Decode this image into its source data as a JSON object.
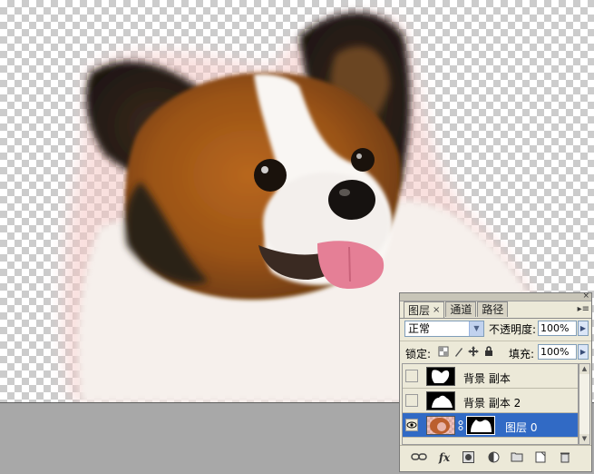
{
  "panel": {
    "tabs": [
      {
        "label": "图层",
        "close": "×"
      },
      {
        "label": "通道"
      },
      {
        "label": "路径"
      }
    ],
    "close_glyph": "×",
    "menu_glyph": "▸≡",
    "blend_mode": "正常",
    "opacity_label": "不透明度:",
    "opacity_value": "100%",
    "lock_label": "锁定:",
    "lock_icons": [
      "lock-transparent-icon",
      "lock-paint-icon",
      "lock-move-icon",
      "lock-all-icon"
    ],
    "fill_label": "填充:",
    "fill_value": "100%",
    "layers": [
      {
        "name": "背景 副本",
        "visible": false,
        "selected": false,
        "thumb": "mask-thumbnail"
      },
      {
        "name": "背景 副本 2",
        "visible": false,
        "selected": false,
        "thumb": "mask-thumbnail"
      },
      {
        "name": "图层 0",
        "visible": true,
        "selected": true,
        "thumb": "image-and-mask-thumbnail"
      }
    ],
    "bottom_icons": [
      "link-layers-icon",
      "fx-icon",
      "add-mask-icon",
      "adjustment-layer-icon",
      "new-group-icon",
      "new-layer-icon",
      "trash-icon"
    ],
    "fx_label": "fx"
  },
  "colors": {
    "selection": "#316ac5",
    "panel_bg": "#ece9d8",
    "workspace_bg": "#a8a8a8"
  }
}
